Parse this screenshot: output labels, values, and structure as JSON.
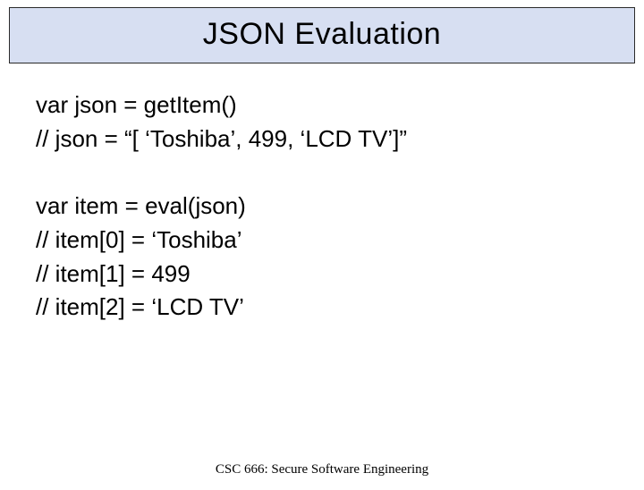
{
  "slide": {
    "title": "JSON Evaluation",
    "block1": {
      "line1": "var json = getItem()",
      "line2": "// json = “[ ‘Toshiba’, 499, ‘LCD TV’]”"
    },
    "block2": {
      "line1": "var item = eval(json)",
      "line2": "// item[0] = ‘Toshiba’",
      "line3": "// item[1] = 499",
      "line4": "// item[2] = ‘LCD TV’"
    },
    "footer": "CSC 666: Secure Software Engineering"
  }
}
